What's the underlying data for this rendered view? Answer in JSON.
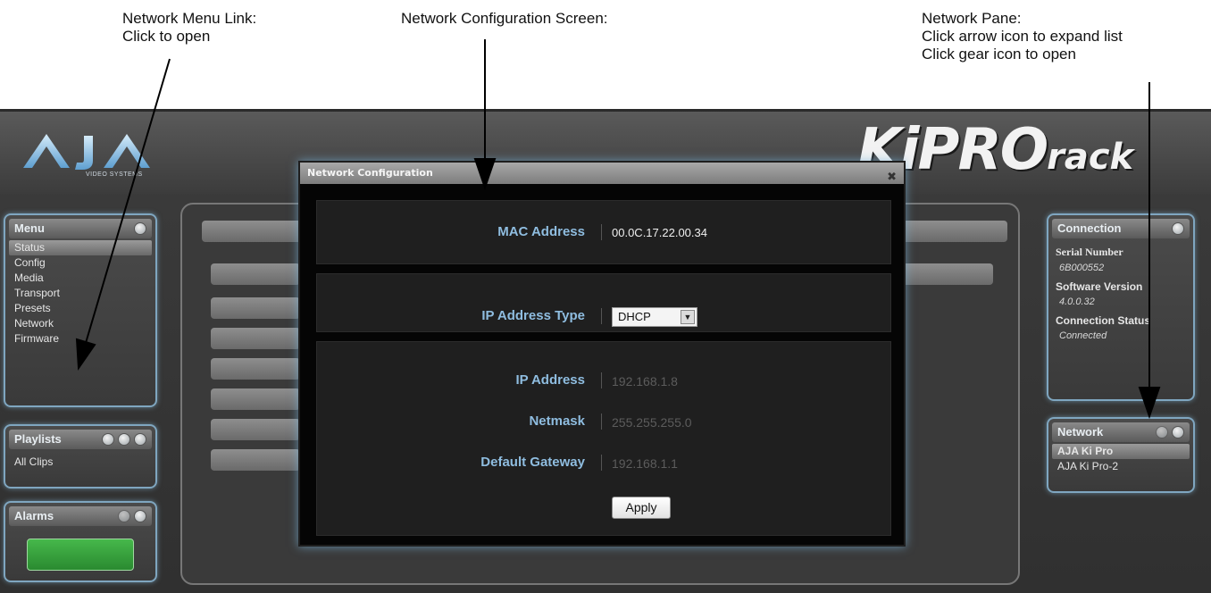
{
  "callouts": {
    "left": {
      "line1": "Network Menu Link:",
      "line2": "Click to open"
    },
    "middle": {
      "line1": "Network Configuration Screen:"
    },
    "right": {
      "line1": "Network Pane:",
      "line2": "Click arrow icon to expand list",
      "line3": "Click gear icon to open"
    }
  },
  "branding": {
    "aja_sub": "VIDEO SYSTEMS",
    "product_main": "KiPRO",
    "product_suffix": "rack"
  },
  "menu": {
    "title": "Menu",
    "items": [
      "Status",
      "Config",
      "Media",
      "Transport",
      "Presets",
      "Network",
      "Firmware"
    ],
    "active_item": "Status"
  },
  "playlists": {
    "title": "Playlists",
    "items": [
      "All Clips"
    ]
  },
  "alarms": {
    "title": "Alarms",
    "indicator_color": "#3aa83f"
  },
  "connection": {
    "title": "Connection",
    "serial_label": "Serial Number",
    "serial_value": "6B000552",
    "software_label": "Software Version",
    "software_value": "4.0.0.32",
    "status_label": "Connection Status",
    "status_value": "Connected"
  },
  "network_pane": {
    "title": "Network",
    "items": [
      "AJA Ki Pro",
      "AJA Ki Pro-2"
    ],
    "active_item": "AJA Ki Pro"
  },
  "dialog": {
    "title": "Network Configuration",
    "close_symbol": "✖",
    "mac": {
      "label": "MAC Address",
      "value": "00.0C.17.22.00.34"
    },
    "ip_type": {
      "label": "IP Address Type",
      "value": "DHCP",
      "arrow": "▼"
    },
    "ip": {
      "label": "IP Address",
      "value": "192.168.1.8"
    },
    "netmask": {
      "label": "Netmask",
      "value": "255.255.255.0"
    },
    "gateway": {
      "label": "Default Gateway",
      "value": "192.168.1.1"
    },
    "apply_label": "Apply"
  },
  "colors": {
    "accent_label": "#8fbde0",
    "panel_glow": "#7fa6c0"
  }
}
